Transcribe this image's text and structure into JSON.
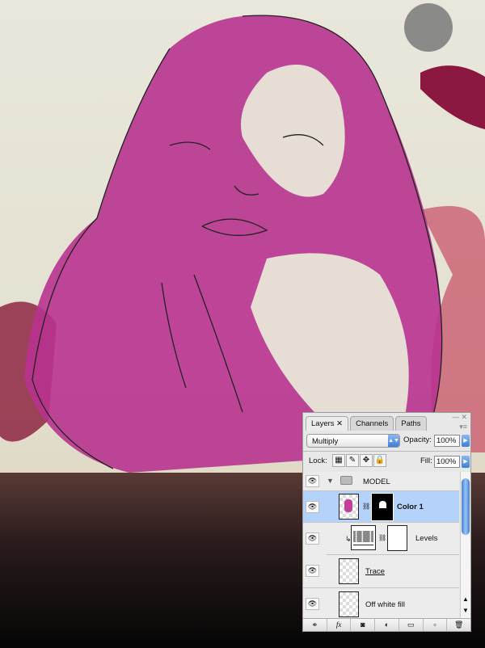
{
  "tabs": [
    {
      "label": "Layers"
    },
    {
      "label": "Channels"
    },
    {
      "label": "Paths"
    }
  ],
  "blend_mode": "Multiply",
  "opacity_label": "Opacity:",
  "opacity": "100%",
  "lock_label": "Lock:",
  "fill_label": "Fill:",
  "fill": "100%",
  "layers": [
    {
      "name": "MODEL",
      "type": "group",
      "visible": true
    },
    {
      "name": "Color 1",
      "selected": true,
      "visible": true
    },
    {
      "name": "Levels",
      "type": "adjustment",
      "visible": true
    },
    {
      "name": "Trace",
      "visible": true
    },
    {
      "name": "Off white fill",
      "visible": true
    }
  ],
  "colors": {
    "magenta": "#b8338f",
    "selection": "#b4d2fa",
    "paper": "#e8e6d8"
  }
}
